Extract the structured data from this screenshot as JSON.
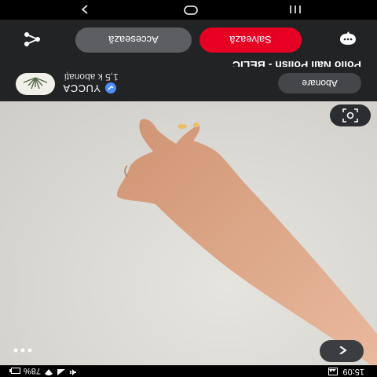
{
  "status_bar": {
    "time": "15:09",
    "battery": "78%",
    "icons": [
      "image-icon",
      "wifi-icon",
      "signal-icon",
      "mute-icon",
      "battery-icon"
    ]
  },
  "pin": {
    "title": "Polio Nail Polish - BELIC"
  },
  "profile": {
    "name": "YUCCA",
    "followers": "1,5 k abonați",
    "follow_label": "Abonare"
  },
  "actions": {
    "visit_label": "Accesează",
    "save_label": "Salvează"
  },
  "colors": {
    "save": "#e60023",
    "panel": "#222325",
    "verified": "#4f8ef7"
  }
}
